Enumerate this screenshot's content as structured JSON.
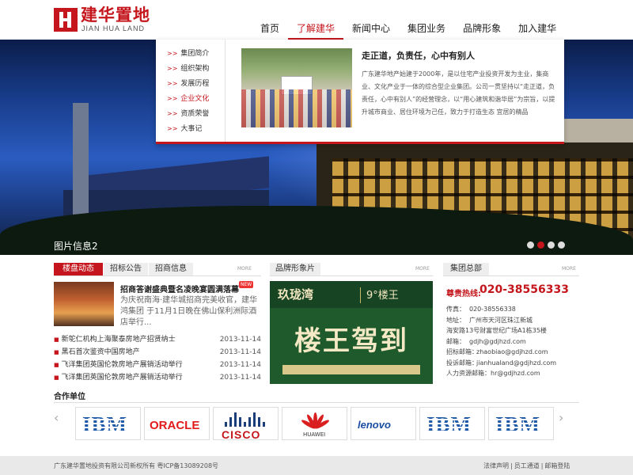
{
  "header": {
    "logo_cn": "建华置地",
    "logo_en": "JIAN HUA LAND",
    "nav": [
      {
        "label": "首页"
      },
      {
        "label": "了解建华"
      },
      {
        "label": "新闻中心"
      },
      {
        "label": "集团业务"
      },
      {
        "label": "品牌形象"
      },
      {
        "label": "加入建华"
      }
    ],
    "active_nav": "了解建华"
  },
  "dropdown": {
    "menu": [
      {
        "label": "集团简介"
      },
      {
        "label": "组织架构"
      },
      {
        "label": "发展历程"
      },
      {
        "label": "企业文化"
      },
      {
        "label": "资质荣誉"
      },
      {
        "label": "大事记"
      }
    ],
    "arrow_glyph": ">>",
    "active_item": "企业文化",
    "title": "走正道，负责任，心中有别人",
    "text": "广东建华地产始建于2000年，是以住宅产业投资开发为主业，集商业、文化产业于一体的综合型企业集团。公司一贯坚持以“走正道，负责任，心中有别人”的经营理念，以“用心建筑和谐华居”为宗旨，以提升城市商业、居住环境为己任，致力于打造生态 宜居的精品"
  },
  "banner": {
    "caption": "图片信息2",
    "dots": 4,
    "active_dot": 2
  },
  "news_panel": {
    "tabs": [
      {
        "label": "楼盘动态"
      },
      {
        "label": "招标公告"
      },
      {
        "label": "招商信息"
      }
    ],
    "more": "MORE",
    "feature": {
      "title": "招商答谢盛典暨名凌晚宴圆满落幕",
      "badge": "NEW",
      "text": "为庆祝南海·建华城招商完美收官，建华鸿集团 于11月1日晚在佛山保利洲际酒店举行..."
    },
    "bullet": "■",
    "items": [
      {
        "title": "新鸵仁机构上海聚泰房地产招贤纳士",
        "date": "2013-11-14"
      },
      {
        "title": "黑石首次鉴资中国房地产",
        "date": "2013-11-14"
      },
      {
        "title": "飞洋集团英国伦敦房地产展销活动举行",
        "date": "2013-11-14"
      },
      {
        "title": "飞洋集团英国伦敦房地产展销活动举行",
        "date": "2013-11-14"
      }
    ]
  },
  "brand_panel": {
    "tab": "品牌形象片",
    "more": "MORE",
    "ad": {
      "logo1": "玖珑湾",
      "logo2": "9°楼王",
      "slogan": "楼王驾到"
    }
  },
  "contact_panel": {
    "tab": "集团总部",
    "more": "MORE",
    "hotline_label": "尊贵热线:",
    "hotline": "020-38556333",
    "rows": [
      {
        "label": "传真：",
        "value": "020-38556338"
      },
      {
        "label": "地址：",
        "value": "广州市天河区珠江新城"
      },
      {
        "label": "",
        "value": "海安路13号财富世纪广场A1栋35楼"
      },
      {
        "label": "邮箱：",
        "value": "gdjh@gdjhzd.com"
      },
      {
        "label": "招标邮箱：",
        "value": "zhaobiao@gdjhzd.com"
      },
      {
        "label": "投诉邮箱：",
        "value": "jianhualand@gdjhzd.com"
      },
      {
        "label": "人力资源邮箱：",
        "value": "hr@gdjhzd.com"
      }
    ]
  },
  "partners": {
    "title": "合作单位",
    "prev": "‹",
    "next": "›",
    "logos": [
      {
        "name": "IBM",
        "kind": "ibm"
      },
      {
        "name": "ORACLE",
        "kind": "oracle"
      },
      {
        "name": "CISCO",
        "kind": "cisco"
      },
      {
        "name": "HUAWEI",
        "kind": "huawei"
      },
      {
        "name": "lenovo",
        "kind": "lenovo"
      },
      {
        "name": "IBM",
        "kind": "ibm"
      },
      {
        "name": "IBM",
        "kind": "ibm"
      }
    ]
  },
  "footer": {
    "copyright": "广东建华置地投资有限公司新权所有  粤ICP备13089208号",
    "links": [
      {
        "label": "法律声明"
      },
      {
        "label": "员工通道"
      },
      {
        "label": "邮箱登陆"
      }
    ],
    "separator": "|"
  },
  "colors": {
    "brand_red": "#c4161c",
    "ad_green": "#1f5a2c",
    "footer_bg": "#e9e9e9"
  }
}
